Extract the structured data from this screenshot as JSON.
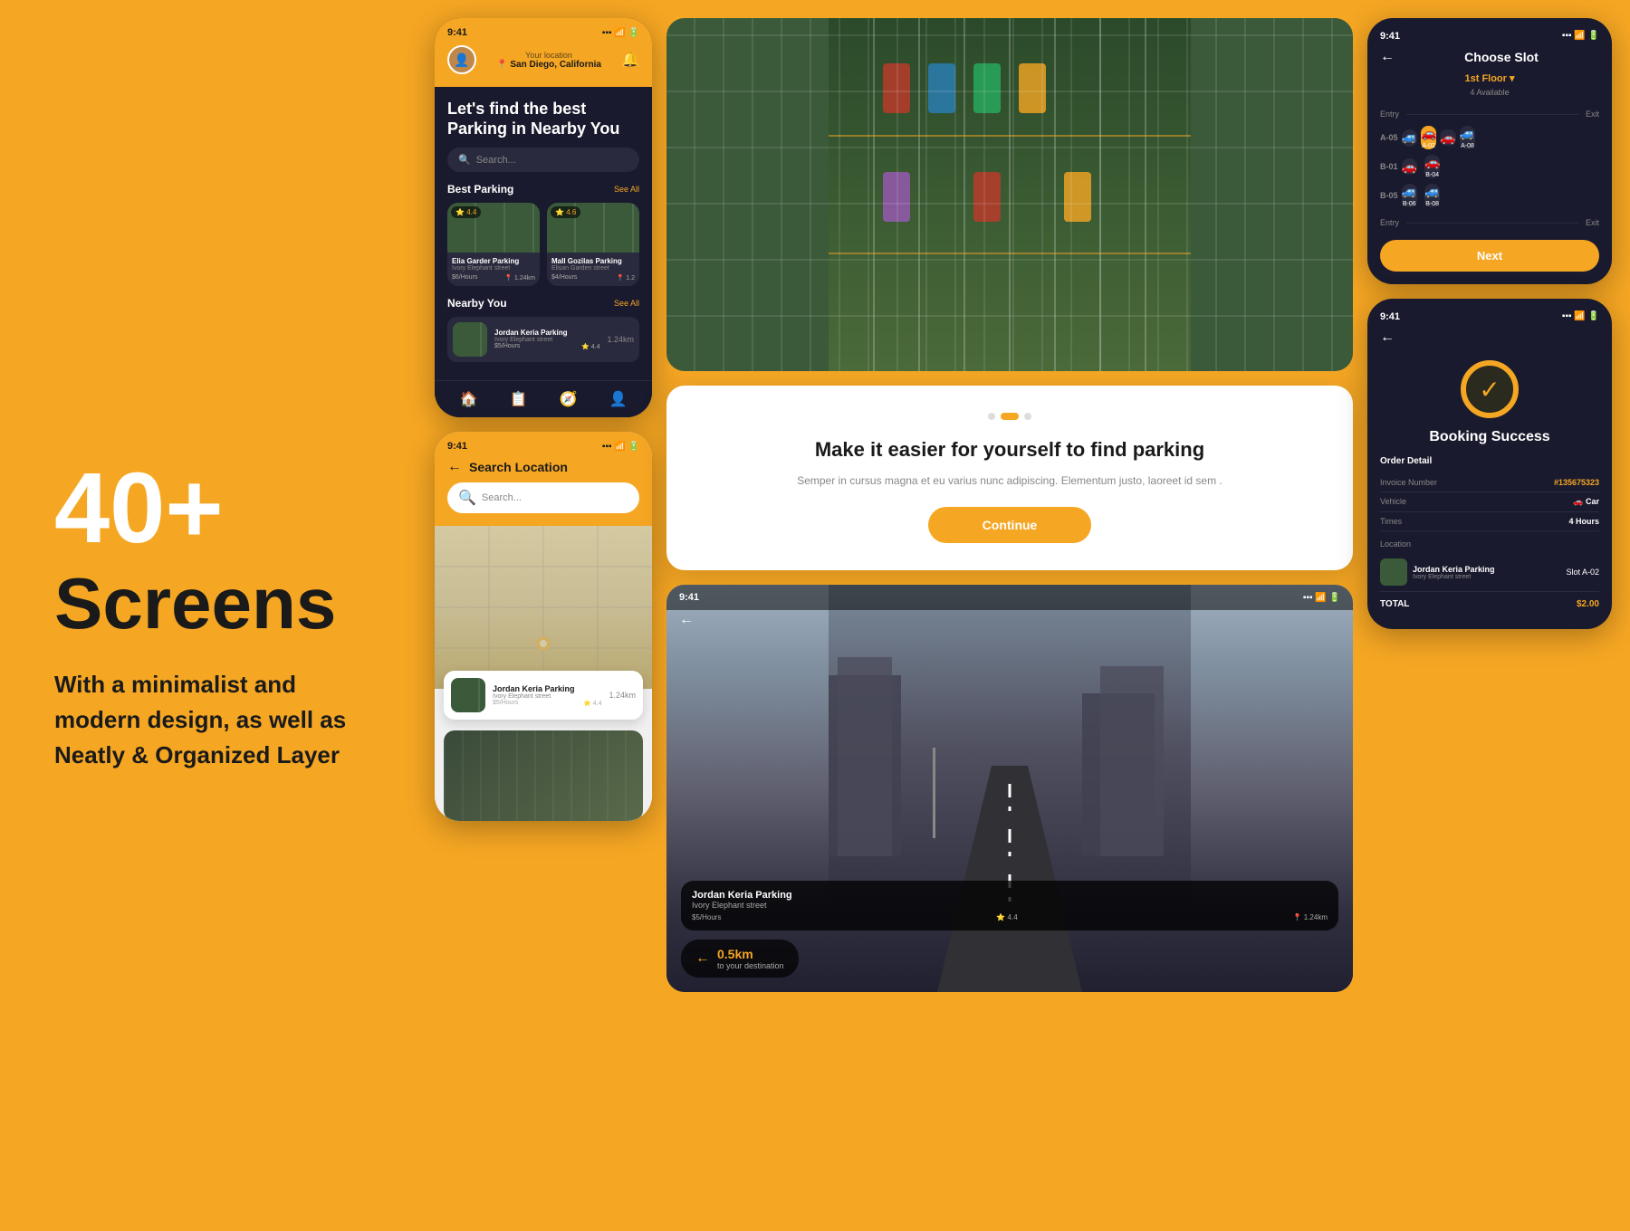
{
  "hero": {
    "number": "40+",
    "screens_label": "Screens",
    "description": "With a minimalist and modern design, as well as Neatly & Organized Layer"
  },
  "phone_main": {
    "time": "9:41",
    "location_label": "Your location",
    "location_name": "San Diego, California",
    "hero_text": "Let's find the best Parking in Nearby You",
    "search_placeholder": "Search...",
    "best_parking_label": "Best Parking",
    "see_all_label": "See All",
    "nearby_label": "Nearby You",
    "see_all2_label": "See All",
    "parking1": {
      "name": "Elia Garder Parking",
      "address": "Ivory Elephant street",
      "price": "$6/Hours",
      "distance": "1.24km",
      "rating": "4.4"
    },
    "parking2": {
      "name": "Mall Gozilas Parking",
      "address": "Elisan Garden street",
      "price": "$4/Hours",
      "distance": "1.2",
      "rating": "4.6"
    },
    "nearby": {
      "name": "Jordan Keria Parking",
      "address": "Ivory Elephant street",
      "price": "$5/Hours",
      "distance": "1.24km",
      "rating": "4.4"
    }
  },
  "phone_search": {
    "time": "9:41",
    "title": "Search Location",
    "search_placeholder": "Search...",
    "result": {
      "name": "Jordan Keria Parking",
      "address": "Ivory Elephant street",
      "price": "$5/Hours",
      "distance": "1.24km",
      "rating": "4.4"
    }
  },
  "onboarding": {
    "title": "Make it easier for yourself to find parking",
    "description": "Semper in cursus magna et eu varius nunc adipiscing. Elementum justo, laoreet id sem .",
    "continue_btn": "Continue"
  },
  "street_screen": {
    "time": "9:41",
    "parking_name": "Jordan Keria Parking",
    "parking_address": "Ivory Elephant street",
    "price": "$5/Hours",
    "rating": "4.4",
    "distance": "1.24km",
    "distance_badge": "0.5km",
    "distance_sub": "to your destination"
  },
  "choose_slot": {
    "time": "9:41",
    "title": "Choose Slot",
    "floor": "1st Floor ▾",
    "available": "4 Available",
    "entry_label": "Entry",
    "exit_label": "Exit",
    "entry2_label": "Entry",
    "exit2_label": "Exit",
    "next_btn": "Next",
    "slots_row1": [
      "A-02",
      "A-05",
      "",
      "A-08"
    ],
    "slots_row2": [
      "B-01",
      "",
      "B-04",
      "B-05"
    ],
    "slots_row3": [
      "B-06",
      "",
      "B-08",
      ""
    ]
  },
  "booking_success": {
    "time": "9:41",
    "title": "Booking Success",
    "order_detail_label": "Order Detail",
    "invoice_label": "Invoice Number",
    "invoice_val": "#135675323",
    "vehicle_label": "Vehicle",
    "vehicle_val": "🚗 Car",
    "times_label": "Times",
    "times_val": "4 Hours",
    "location_label": "Location",
    "location_name": "Jordan Keria Parking",
    "location_addr": "Ivory Elephant street",
    "slot_label": "Slot A-02",
    "total_label": "TOTAL",
    "total_val": "$2.00"
  }
}
